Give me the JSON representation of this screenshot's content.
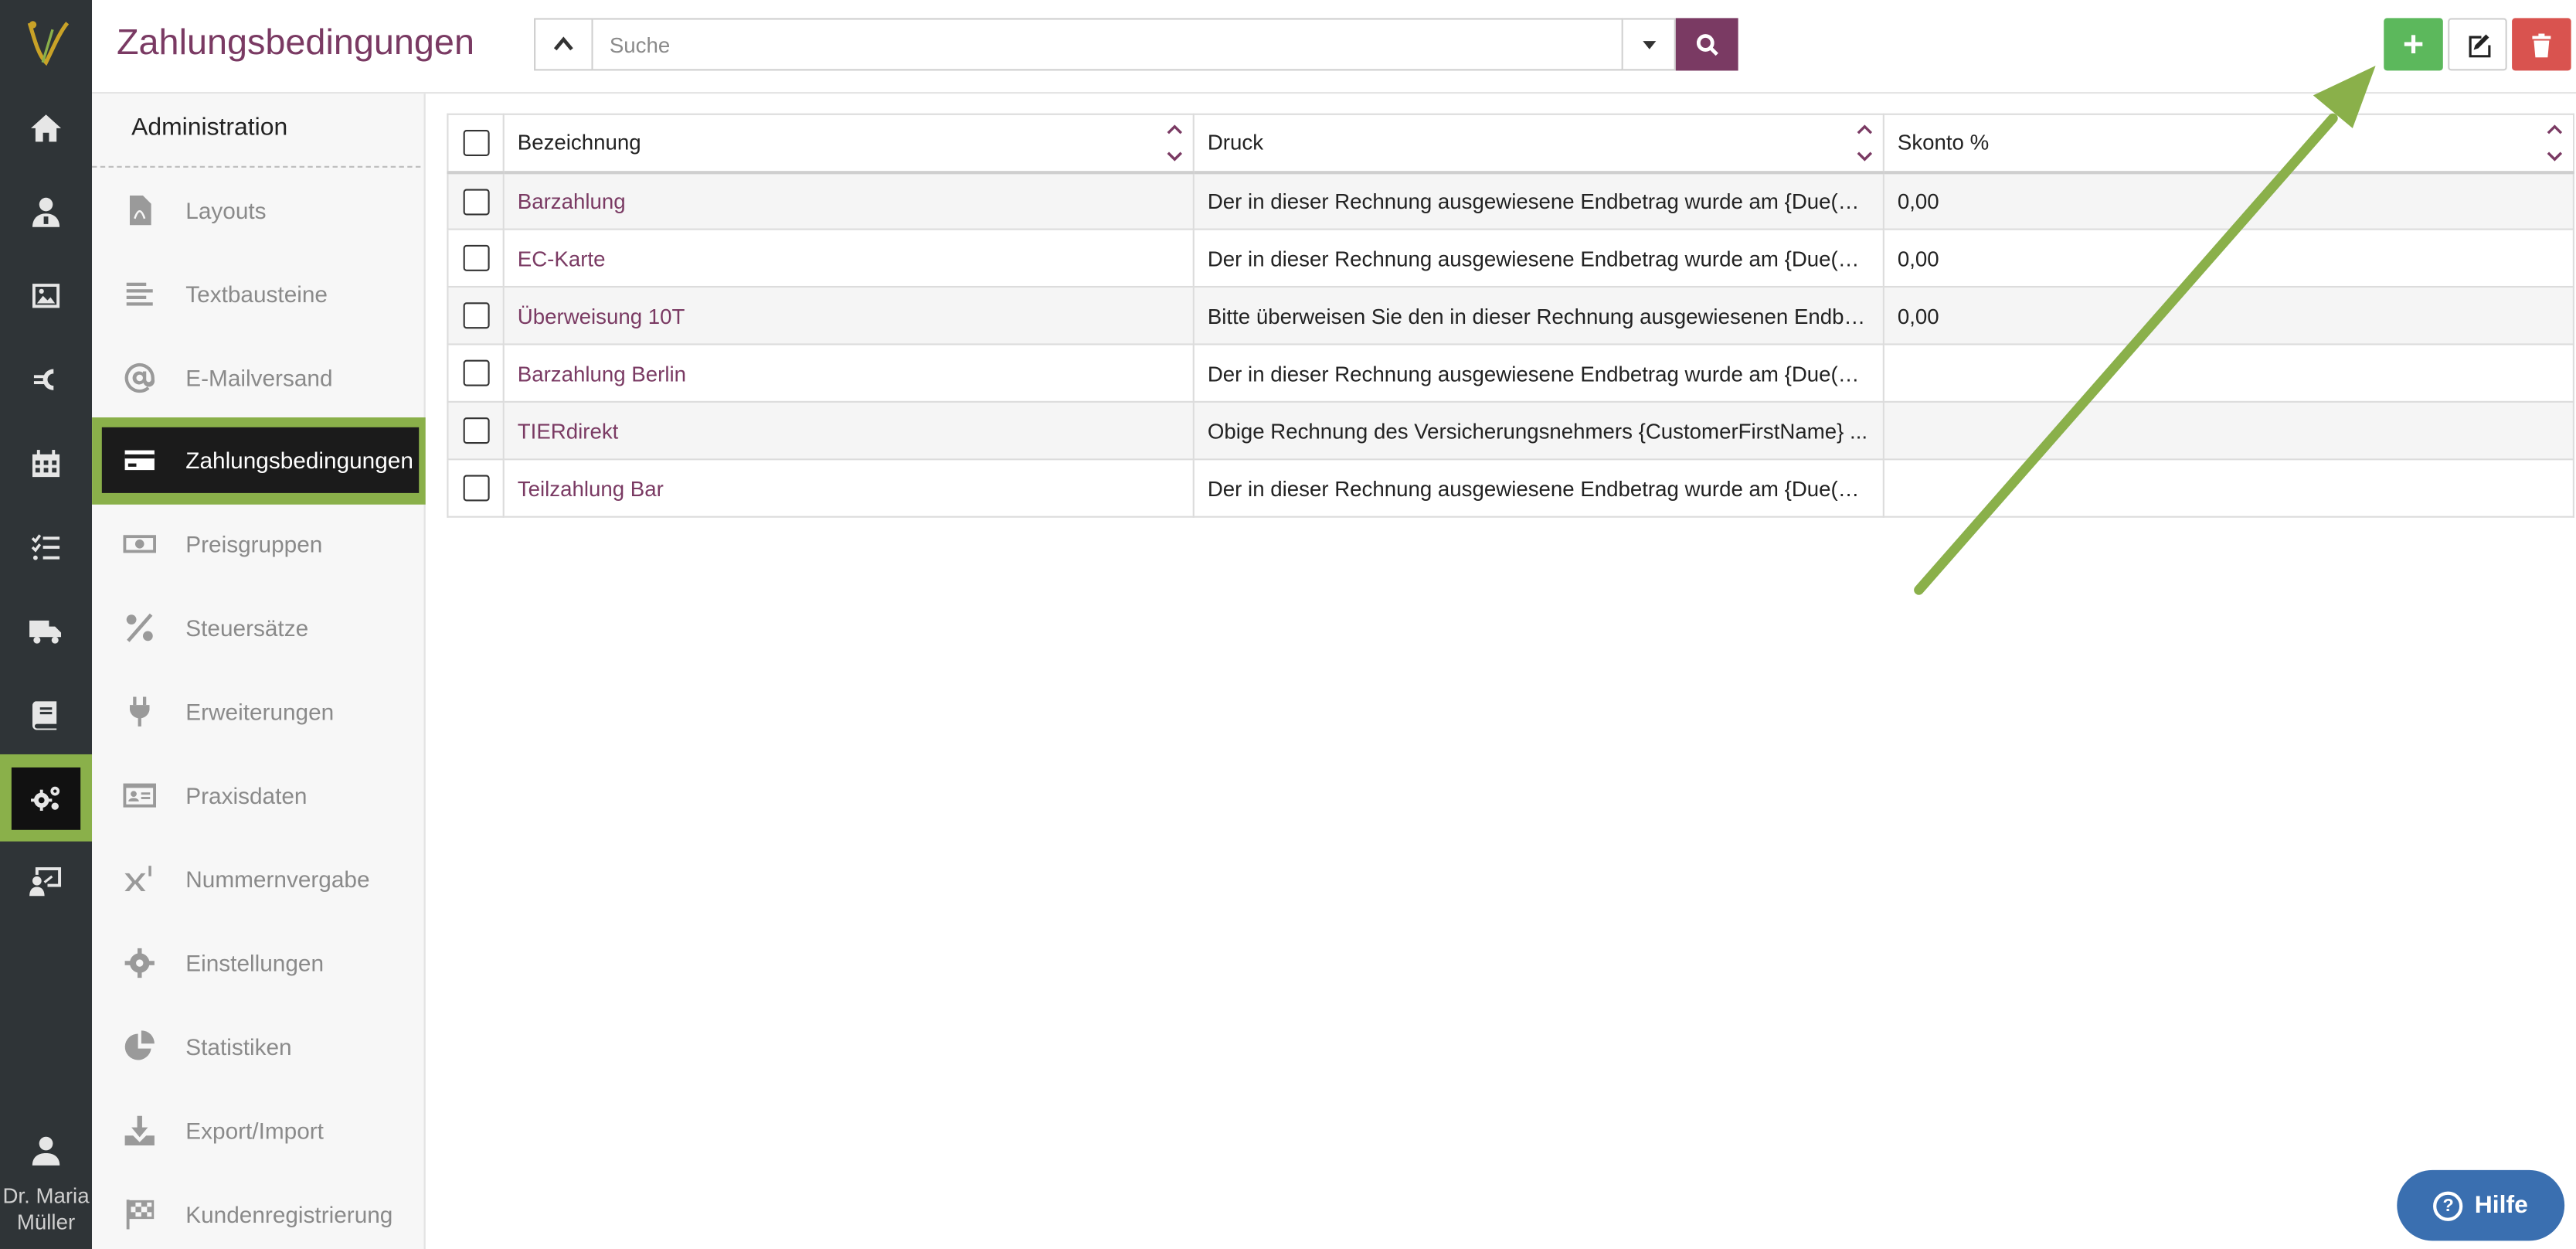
{
  "header": {
    "title": "Zahlungsbedingungen"
  },
  "search": {
    "placeholder": "Suche"
  },
  "toolbar": {
    "add": "+",
    "edit": "edit",
    "delete": "delete"
  },
  "rail": {
    "user_name": "Dr. Maria Müller"
  },
  "subnav": {
    "heading": "Administration",
    "items": [
      {
        "label": "Layouts",
        "icon": "pdf-file-icon"
      },
      {
        "label": "Textbausteine",
        "icon": "align-left-icon"
      },
      {
        "label": "E-Mailversand",
        "icon": "at-icon"
      },
      {
        "label": "Zahlungsbedingungen",
        "icon": "credit-card-icon",
        "active": true
      },
      {
        "label": "Preisgruppen",
        "icon": "money-bill-icon"
      },
      {
        "label": "Steuersätze",
        "icon": "percent-icon"
      },
      {
        "label": "Erweiterungen",
        "icon": "plug-icon"
      },
      {
        "label": "Praxisdaten",
        "icon": "id-card-icon"
      },
      {
        "label": "Nummernvergabe",
        "icon": "superscript-icon"
      },
      {
        "label": "Einstellungen",
        "icon": "gear-icon"
      },
      {
        "label": "Statistiken",
        "icon": "pie-chart-icon"
      },
      {
        "label": "Export/Import",
        "icon": "download-icon"
      },
      {
        "label": "Kundenregistrierung",
        "icon": "checkered-flag-icon"
      }
    ]
  },
  "table": {
    "columns": [
      "Bezeichnung",
      "Druck",
      "Skonto %"
    ],
    "rows": [
      {
        "name": "Barzahlung",
        "druck": "Der in dieser Rechnung ausgewiesene Endbetrag wurde am {Due(0)}...",
        "skonto": "0,00"
      },
      {
        "name": "EC-Karte",
        "druck": "Der in dieser Rechnung ausgewiesene Endbetrag wurde am {Due(0)}...",
        "skonto": "0,00"
      },
      {
        "name": "Überweisung 10T",
        "druck": "Bitte überweisen Sie den in dieser Rechnung ausgewiesenen Endbe...",
        "skonto": "0,00"
      },
      {
        "name": "Barzahlung Berlin",
        "druck": "Der in dieser Rechnung ausgewiesene Endbetrag wurde am {Due(0)}...",
        "skonto": ""
      },
      {
        "name": "TIERdirekt",
        "druck": "Obige Rechnung des Versicherungsnehmers {CustomerFirstName} ...",
        "skonto": ""
      },
      {
        "name": "Teilzahlung Bar",
        "druck": "Der in dieser Rechnung ausgewiesene Endbetrag wurde am {Due(0)}...",
        "skonto": ""
      }
    ]
  },
  "help": {
    "label": "Hilfe"
  },
  "colors": {
    "brand": "#7a3a63",
    "highlight": "#8ab04a",
    "add": "#5cb85c",
    "delete": "#d9534f",
    "help": "#3a6fb0"
  }
}
